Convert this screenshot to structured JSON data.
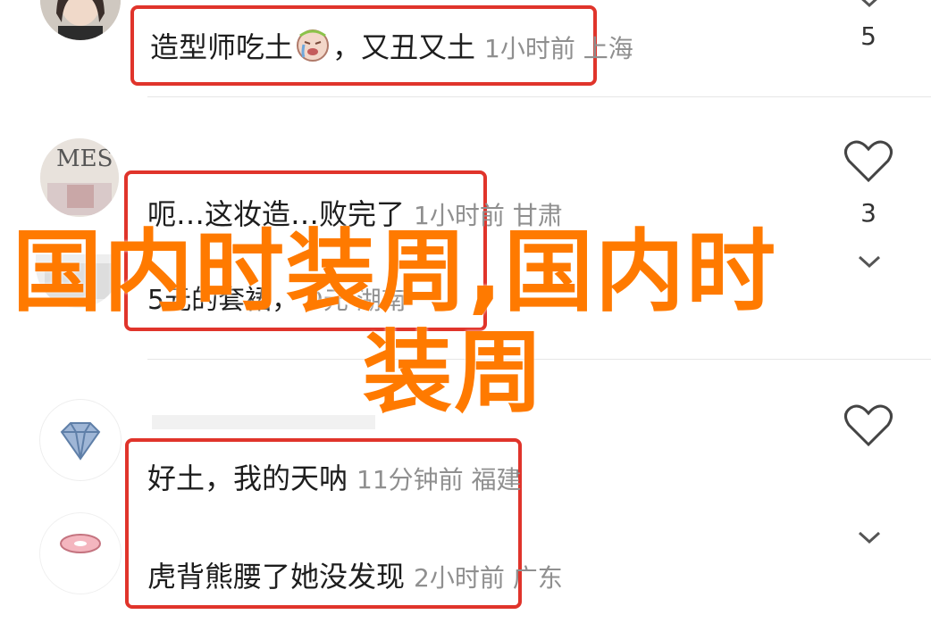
{
  "comments": [
    {
      "text_before": "造型师吃土",
      "text_after": "，又丑又土",
      "meta": "1小时前 上海",
      "likes": "5",
      "emoji": "crying-face-icon"
    },
    {
      "text": "呃…这妆造…败完了",
      "meta": "1小时前 甘肃",
      "likes": "3",
      "avatar_text": "MES"
    },
    {
      "text": "5元的套裙，",
      "meta": "9元 湖南"
    },
    {
      "text": "好土，我的天呐",
      "meta": "11分钟前 福建"
    },
    {
      "text": "虎背熊腰了她没发现",
      "meta": "2小时前 广东"
    }
  ],
  "watermark": {
    "line1": "国内时装周,国内时",
    "line2": "装周"
  },
  "colors": {
    "highlight_box": "#e0342b",
    "watermark": "#ff7a00"
  }
}
